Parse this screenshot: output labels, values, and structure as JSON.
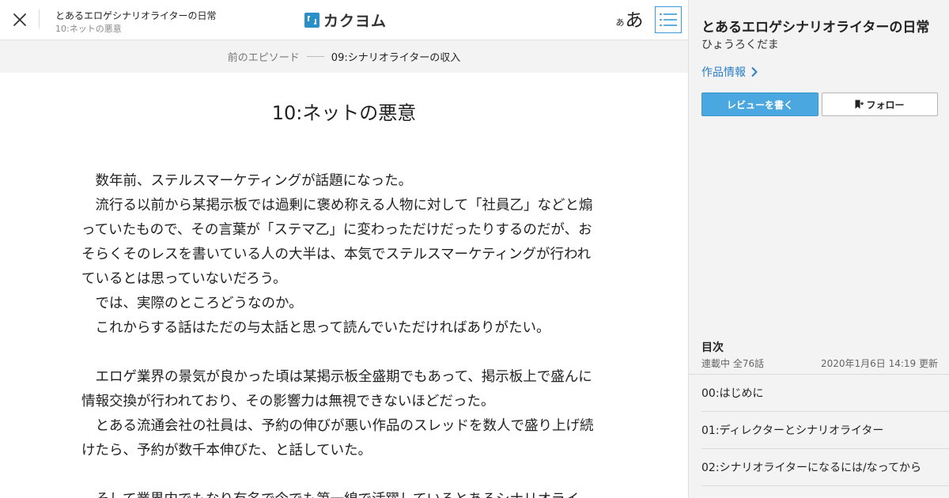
{
  "header": {
    "work_title": "とあるエロゲシナリオライターの日常",
    "episode_subtitle": "10:ネットの悪意",
    "logo_text": "カクヨム",
    "font_small": "あ",
    "font_large": "あ",
    "icons": {
      "close": "close-icon",
      "toc": "list-icon",
      "logo": "kakuyomu-logo-icon"
    }
  },
  "nav": {
    "prev_label": "前のエピソード",
    "prev_title": "09:シナリオライターの収入"
  },
  "episode": {
    "title": "10:ネットの悪意",
    "paragraphs": [
      "　数年前、ステルスマーケティングが話題になった。",
      "　流行る以前から某掲示板では過剰に褒め称える人物に対して「社員乙」などと煽っていたもので、その言葉が「ステマ乙」に変わっただけだったりするのだが、おそらくそのレスを書いている人の大半は、本気でステルスマーケティングが行われているとは思っていないだろう。",
      "　では、実際のところどうなのか。",
      "　これからする話はただの与太話と思って読んでいただければありがたい。",
      "",
      "　エロゲ業界の景気が良かった頃は某掲示板全盛期でもあって、掲示板上で盛んに情報交換が行われており、その影響力は無視できないほどだった。",
      "　とある流通会社の社員は、予約の伸びが悪い作品のスレッドを数人で盛り上げ続けたら、予約が数千本伸びた、と話していた。",
      "",
      "　そして業界内でもなり有名で今でも第一線で活躍しているとあるシナリオライ"
    ]
  },
  "sidebar": {
    "title": "とあるエロゲシナリオライターの日常",
    "author": "ひょうろくだま",
    "info_link": "作品情報",
    "review_button": "レビューを書く",
    "follow_button": "フォロー",
    "toc_heading": "目次",
    "toc_status": "連載中 全76話",
    "toc_updated": "2020年1月6日 14:19 更新",
    "toc_items": [
      "00:はじめに",
      "01:ディレクターとシナリオライター",
      "02:シナリオライターになるには/なってから"
    ],
    "icons": {
      "info": "chevron-right-icon",
      "follow": "bookmark-plus-icon"
    }
  },
  "colors": {
    "accent": "#4ba7df",
    "link": "#2b7fc4",
    "logo": "#2b8fc9",
    "sidebar_bg": "#f3f3f3"
  }
}
